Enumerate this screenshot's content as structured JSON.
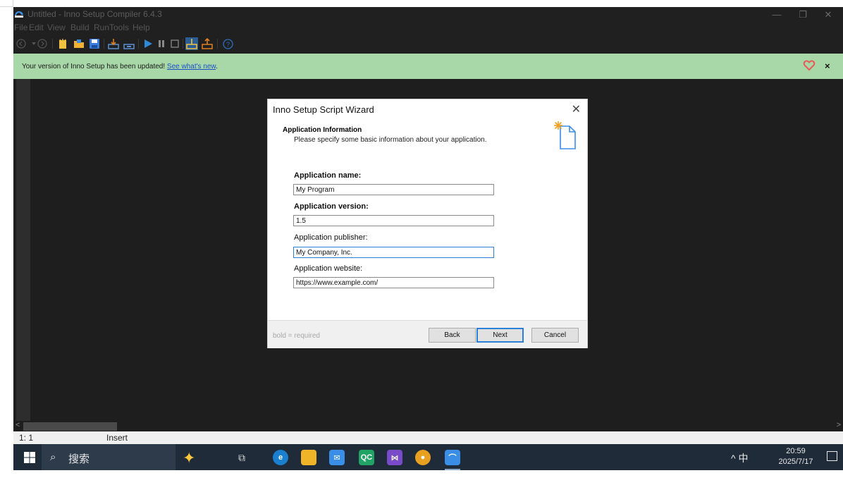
{
  "window": {
    "title": "Untitled - Inno Setup Compiler 6.4.3",
    "minimize_glyph": "—",
    "maximize_glyph": "❐",
    "close_glyph": "✕"
  },
  "menu": [
    "File",
    "Edit",
    "View",
    "Build",
    "Run",
    "Tools",
    "Help"
  ],
  "banner": {
    "message": "Your version of Inno Setup has been updated! ",
    "link": "See what's new",
    "suffix": ".",
    "close": "×"
  },
  "status": {
    "position": "1:  1",
    "mode": "Insert"
  },
  "dialog": {
    "title": "Inno Setup Script Wizard",
    "close": "✕",
    "heading": "Application Information",
    "subheading": "Please specify some basic information about your application.",
    "fields": [
      {
        "label": "Application name:",
        "value": "My Program",
        "required": true
      },
      {
        "label": "Application version:",
        "value": "1.5",
        "required": true
      },
      {
        "label": "Application publisher:",
        "value": "My Company, Inc.",
        "required": false
      },
      {
        "label": "Application website:",
        "value": "https://www.example.com/",
        "required": false
      }
    ],
    "footer_hint": "bold = required",
    "buttons": {
      "back": "Back",
      "next": "Next",
      "cancel": "Cancel"
    }
  },
  "taskbar": {
    "search_text": "搜索",
    "ime": "中",
    "tray_chevron": "^",
    "time": "20:59",
    "date": "2025/7/17",
    "apps": [
      "task-view",
      "edge",
      "file-explorer",
      "mail",
      "qc",
      "visual-studio",
      "chrome",
      "inno-setup"
    ]
  },
  "colors": {
    "banner_bg": "#a8d8a8",
    "editor_bg": "#1e1e1e",
    "accent": "#2b7fd6",
    "taskbar_bg": "#1f2b38"
  }
}
